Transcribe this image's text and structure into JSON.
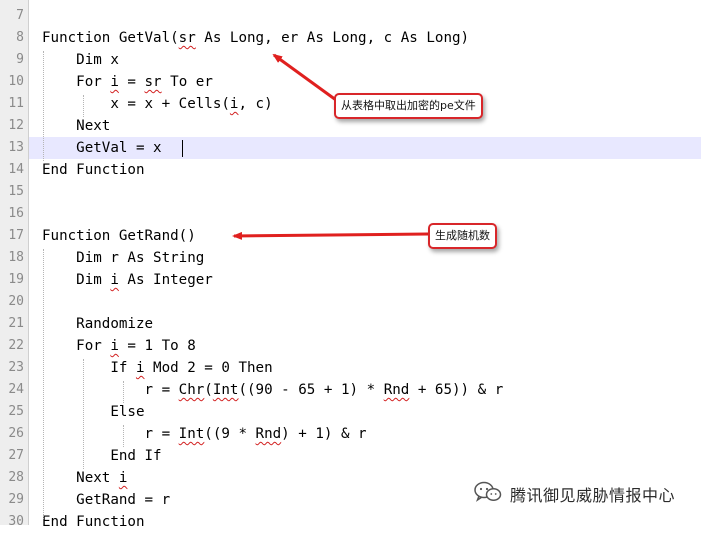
{
  "editor": {
    "line_numbers": [
      "7",
      "8",
      "9",
      "10",
      "11",
      "12",
      "13",
      "14",
      "15",
      "16",
      "17",
      "18",
      "19",
      "20",
      "21",
      "22",
      "23",
      "24",
      "25",
      "26",
      "27",
      "28",
      "29",
      "30"
    ],
    "lines": [
      "",
      "Function GetVal(sr As Long, er As Long, c As Long)",
      "    Dim x",
      "    For i = sr To er",
      "        x = x + Cells(i, c)",
      "    Next",
      "    GetVal = x",
      "End Function",
      "",
      "",
      "Function GetRand()",
      "    Dim r As String",
      "    Dim i As Integer",
      "",
      "    Randomize",
      "    For i = 1 To 8",
      "        If i Mod 2 = 0 Then",
      "            r = Chr(Int((90 - 65 + 1) * Rnd + 65)) & r",
      "        Else",
      "            r = Int((9 * Rnd) + 1) & r",
      "        End If",
      "    Next i",
      "    GetRand = r",
      "End Function"
    ],
    "current_line": "13",
    "current_line_color": "#e8e8ff"
  },
  "annotations": {
    "getval_note": "从表格中取出加密的pe文件",
    "getrand_note": "生成随机数",
    "arrow_color": "#e0201f"
  },
  "watermark": {
    "icon": "wechat-icon",
    "text": "腾讯御见威胁情报中心"
  }
}
